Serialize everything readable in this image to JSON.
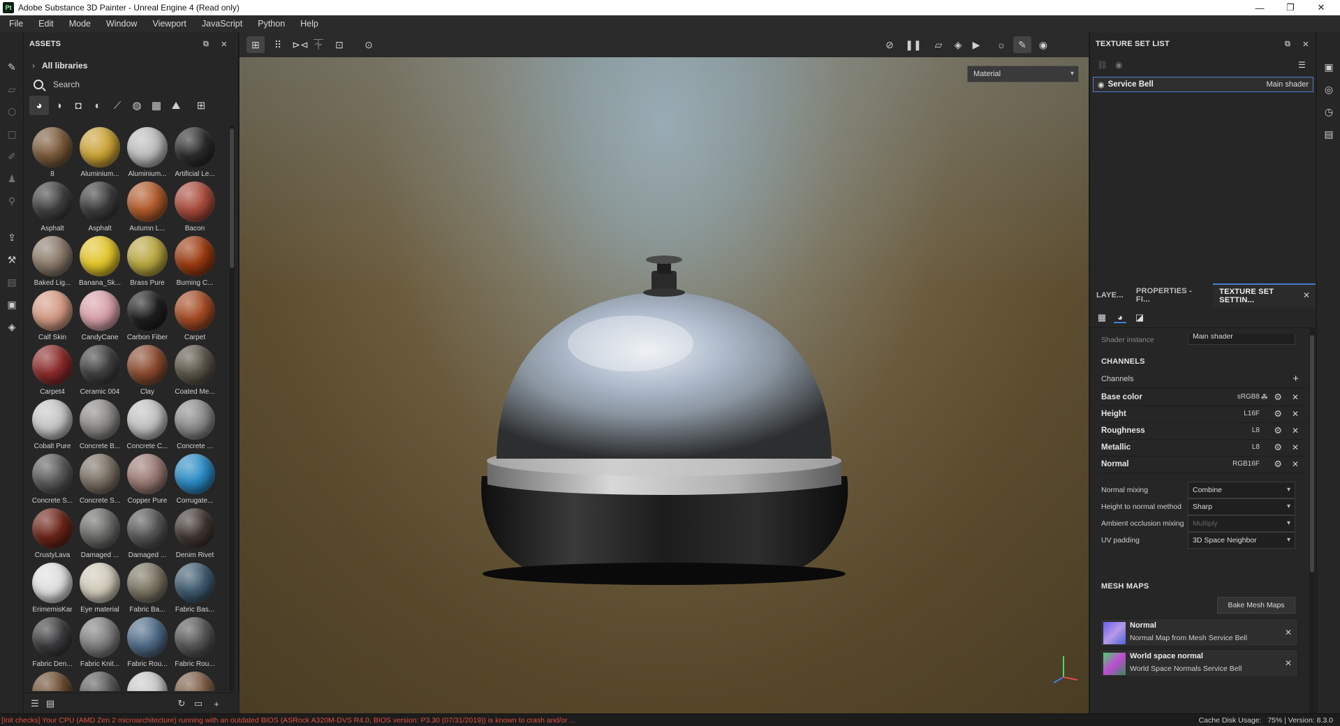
{
  "window": {
    "app_icon": "Pt",
    "title": "Adobe Substance 3D Painter - Unreal Engine 4 (Read only)",
    "controls": [
      "—",
      "❐",
      "✕"
    ]
  },
  "menu": [
    "File",
    "Edit",
    "Mode",
    "Window",
    "Viewport",
    "JavaScript",
    "Python",
    "Help"
  ],
  "assets": {
    "header": "ASSETS",
    "library_label": "All libraries",
    "search_placeholder": "Search",
    "filter_icons": [
      "material-filter-icon",
      "smart-material-icon",
      "smart-mask-icon",
      "filter-icon",
      "brush-icon",
      "particle-icon",
      "texture-icon",
      "environment-icon",
      "grid-view-icon"
    ],
    "tiles": [
      {
        "name": "8",
        "color": "#7a5a3a"
      },
      {
        "name": "Aluminium...",
        "color": "#c9a134"
      },
      {
        "name": "Aluminium...",
        "color": "#bcbcbc"
      },
      {
        "name": "Artificial Le...",
        "color": "#2a2a2a"
      },
      {
        "name": "Asphalt",
        "color": "#3e3e3e"
      },
      {
        "name": "Asphalt",
        "color": "#3a3a3a"
      },
      {
        "name": "Autumn L...",
        "color": "#b05a2a"
      },
      {
        "name": "Bacon",
        "color": "#a84a3a"
      },
      {
        "name": "Baked Lig...",
        "color": "#8a7a6a"
      },
      {
        "name": "Banana_Sk...",
        "color": "#e2c42a"
      },
      {
        "name": "Brass Pure",
        "color": "#b8a640"
      },
      {
        "name": "Burning C...",
        "color": "#9a3a10"
      },
      {
        "name": "Calf Skin",
        "color": "#d49a84"
      },
      {
        "name": "CandyCane",
        "color": "#d8a0a8"
      },
      {
        "name": "Carbon Fiber",
        "color": "#1e1e1e"
      },
      {
        "name": "Carpet",
        "color": "#a24a22"
      },
      {
        "name": "Carpet4",
        "color": "#8a2a2a"
      },
      {
        "name": "Ceramic 004",
        "color": "#3e3e3e"
      },
      {
        "name": "Clay",
        "color": "#8a4a2e"
      },
      {
        "name": "Coated Me...",
        "color": "#5a5448"
      },
      {
        "name": "Cobalt Pure",
        "color": "#c4c4c4"
      },
      {
        "name": "Concrete B...",
        "color": "#8a8884"
      },
      {
        "name": "Concrete C...",
        "color": "#c0c0c0"
      },
      {
        "name": "Concrete ...",
        "color": "#8a8a8a"
      },
      {
        "name": "Concrete S...",
        "color": "#5a5a5a"
      },
      {
        "name": "Concrete S...",
        "color": "#7a7064"
      },
      {
        "name": "Copper Pure",
        "color": "#9a7a74"
      },
      {
        "name": "Corrugate...",
        "color": "#2a8ac4"
      },
      {
        "name": "CrustyLava",
        "color": "#6a2418"
      },
      {
        "name": "Damaged ...",
        "color": "#6a6a68"
      },
      {
        "name": "Damaged ...",
        "color": "#555555"
      },
      {
        "name": "Denim Rivet",
        "color": "#3e3430"
      },
      {
        "name": "ErimemisKar",
        "color": "#dedede"
      },
      {
        "name": "Eye material",
        "color": "#cfc9b8"
      },
      {
        "name": "Fabric Ba...",
        "color": "#7a7462"
      },
      {
        "name": "Fabric Bas...",
        "color": "#3e5a6e"
      },
      {
        "name": "Fabric Den...",
        "color": "#3a3a3c"
      },
      {
        "name": "Fabric Knit...",
        "color": "#7e7e7e"
      },
      {
        "name": "Fabric Rou...",
        "color": "#4e6a86"
      },
      {
        "name": "Fabric Rou...",
        "color": "#555555"
      },
      {
        "name": "",
        "color": "#6a4a2e"
      },
      {
        "name": "",
        "color": "#5a5a5a"
      },
      {
        "name": "",
        "color": "#c8c8c8"
      },
      {
        "name": "",
        "color": "#7a5a42"
      }
    ],
    "footer_icons": [
      "list-view-icon",
      "grid-options-icon",
      "refresh-icon",
      "folder-icon",
      "add-icon"
    ]
  },
  "viewport": {
    "toolbar_left_icons": [
      "select-tool-icon",
      "grid-tool-icon",
      "symmetry-icon",
      "mirror-icon",
      "frame-icon",
      "reset-camera-icon"
    ],
    "toolbar_right_icons": [
      "hide-icon",
      "pause-icon",
      "2d-view-icon",
      "3d-view-icon",
      "camera-icon",
      "lights-icon",
      "paint-mode-icon",
      "screenshot-icon"
    ],
    "display_mode": "Material"
  },
  "texture_set_list": {
    "header": "TEXTURE SET LIST",
    "item_name": "Service Bell",
    "item_shader": "Main shader"
  },
  "tabs": {
    "items": [
      "LAYE...",
      "PROPERTIES - FI...",
      "TEXTURE SET SETTIN..."
    ],
    "active": 2
  },
  "texture_set_settings": {
    "shader_instance_label": "Shader instance",
    "shader_instance_value": "Main shader",
    "channels_header": "CHANNELS",
    "channels_label": "Channels",
    "channels": [
      {
        "name": "Base color",
        "format": "sRGB8",
        "has_color_icon": true
      },
      {
        "name": "Height",
        "format": "L16F",
        "has_color_icon": false
      },
      {
        "name": "Roughness",
        "format": "L8",
        "has_color_icon": false
      },
      {
        "name": "Metallic",
        "format": "L8",
        "has_color_icon": false
      },
      {
        "name": "Normal",
        "format": "RGB16F",
        "has_color_icon": false
      }
    ],
    "properties": [
      {
        "label": "Normal mixing",
        "value": "Combine",
        "disabled": false
      },
      {
        "label": "Height to normal method",
        "value": "Sharp",
        "disabled": false
      },
      {
        "label": "Ambient occlusion mixing",
        "value": "Multiply",
        "disabled": true
      },
      {
        "label": "UV padding",
        "value": "3D Space Neighbor",
        "disabled": false
      }
    ],
    "mesh_maps_header": "MESH MAPS",
    "bake_button": "Bake Mesh Maps",
    "mesh_maps": [
      {
        "title": "Normal",
        "subtitle": "Normal Map from Mesh Service Bell"
      },
      {
        "title": "World space normal",
        "subtitle": "World Space Normals Service Bell"
      }
    ]
  },
  "status": {
    "warning": "[Init checks] Your CPU (AMD Zen 2 microarchitecture) running with an outdated BIOS (ASRock A320M-DVS R4.0, BIOS version: P3.30 (07/31/2019)) is known to crash and/or ...",
    "cache_label": "Cache Disk Usage:",
    "cache_value": "75%",
    "version": "| Version: 8.3.0"
  }
}
